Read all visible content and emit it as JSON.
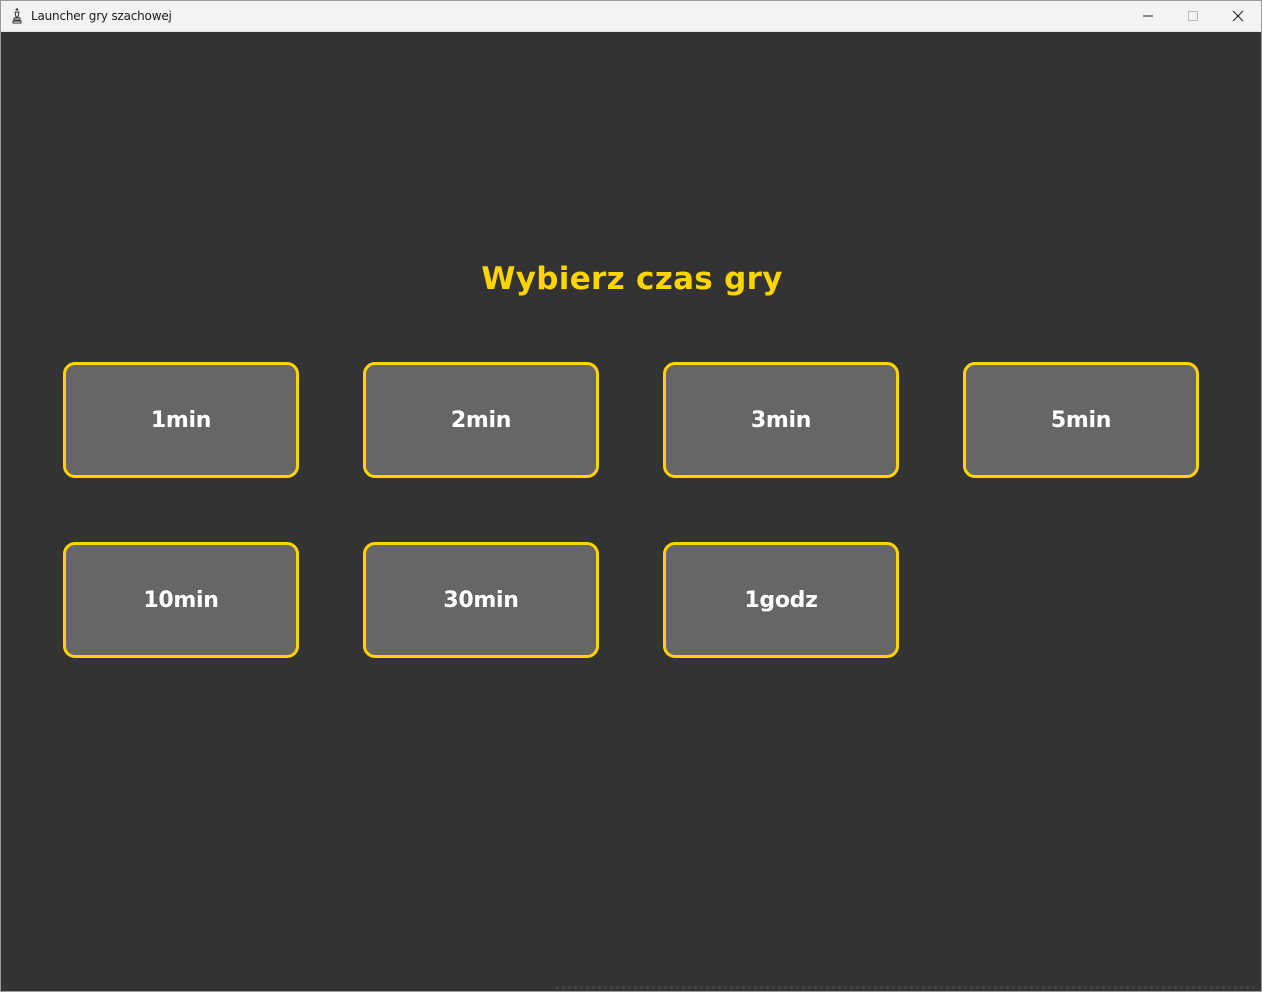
{
  "window": {
    "title": "Launcher gry szachowej",
    "icon": "chess-king-icon",
    "controls": {
      "minimize": "minimize-icon",
      "maximize": "maximize-icon",
      "close": "close-icon"
    }
  },
  "main": {
    "heading": "Wybierz czas gry",
    "options": [
      {
        "label": "1min"
      },
      {
        "label": "2min"
      },
      {
        "label": "3min"
      },
      {
        "label": "5min"
      },
      {
        "label": "10min"
      },
      {
        "label": "30min"
      },
      {
        "label": "1godz"
      }
    ]
  },
  "colors": {
    "background": "#333333",
    "accent": "#ffd500",
    "button_fill": "#666666",
    "button_text": "#ffffff"
  }
}
